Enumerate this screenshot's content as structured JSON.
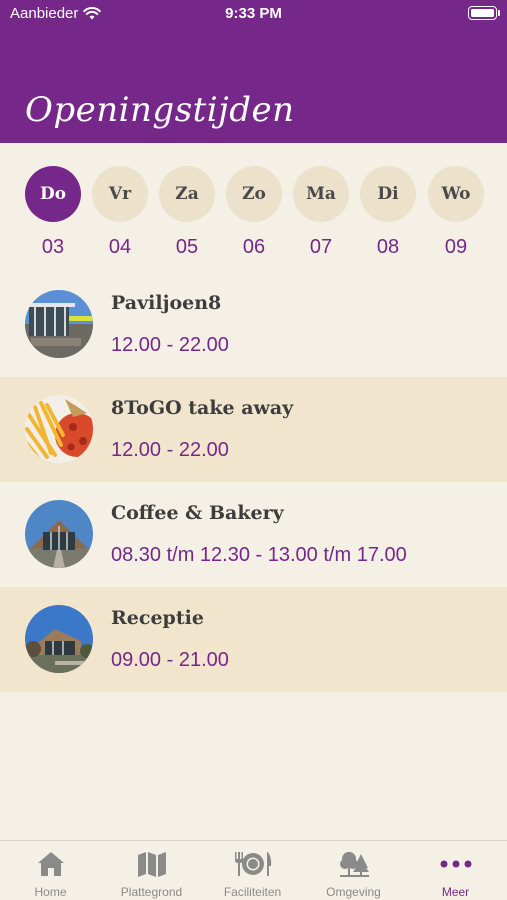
{
  "status_bar": {
    "carrier": "Aanbieder",
    "time": "9:33 PM"
  },
  "header": {
    "title": "Openingstijden"
  },
  "days": [
    {
      "label": "Do",
      "date": "03",
      "active": true
    },
    {
      "label": "Vr",
      "date": "04",
      "active": false
    },
    {
      "label": "Za",
      "date": "05",
      "active": false
    },
    {
      "label": "Zo",
      "date": "06",
      "active": false
    },
    {
      "label": "Ma",
      "date": "07",
      "active": false
    },
    {
      "label": "Di",
      "date": "08",
      "active": false
    },
    {
      "label": "Wo",
      "date": "09",
      "active": false
    }
  ],
  "venues": [
    {
      "name": "Paviljoen8",
      "hours": "12.00 - 22.00",
      "image": "pavilion-photo"
    },
    {
      "name": "8ToGO take away",
      "hours": "12.00 - 22.00",
      "image": "fries-pizza-photo"
    },
    {
      "name": "Coffee & Bakery",
      "hours": "08.30 t/m 12.30 - 13.00 t/m 17.00",
      "image": "bakery-building-photo"
    },
    {
      "name": "Receptie",
      "hours": "09.00 - 21.00",
      "image": "reception-building-photo"
    }
  ],
  "tabs": [
    {
      "label": "Home",
      "icon": "house-icon",
      "active": false
    },
    {
      "label": "Plattegrond",
      "icon": "map-icon",
      "active": false
    },
    {
      "label": "Faciliteiten",
      "icon": "fork-plate-knife-icon",
      "active": false
    },
    {
      "label": "Omgeving",
      "icon": "trees-icon",
      "active": false
    },
    {
      "label": "Meer",
      "icon": "more-dots-icon",
      "active": true
    }
  ],
  "colors": {
    "brand_purple": "#76278a",
    "background": "#f4f0e6",
    "alt_row": "#f1e6cd",
    "day_circle": "#ece2cc",
    "inactive_icon": "#8a8a8a"
  }
}
